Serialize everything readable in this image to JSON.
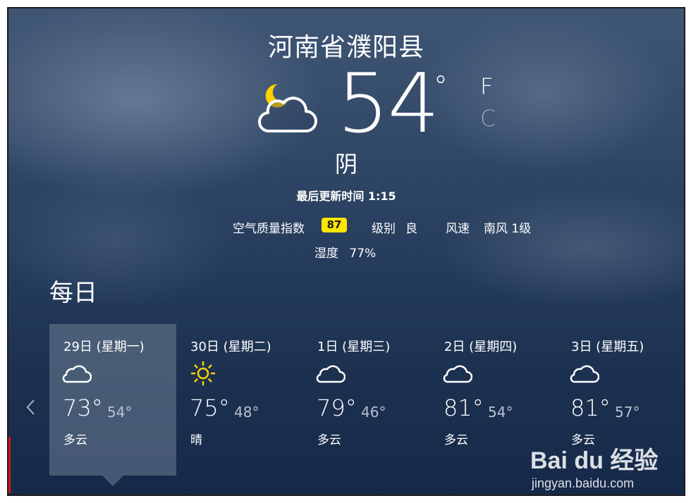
{
  "location": {
    "name": "河南省濮阳县"
  },
  "current": {
    "icon": "partly-cloudy-night-icon",
    "temperature": "54",
    "degree_symbol": "°",
    "unit_f": "F",
    "unit_c": "C",
    "active_unit": "F",
    "condition": "阴",
    "last_updated": "最后更新时间 1:15"
  },
  "details": {
    "aqi_label": "空气质量指数",
    "aqi_value": "87",
    "aqi_color": "#ffe600",
    "level_label": "级别",
    "level_value": "良",
    "wind_label": "风速",
    "wind_value": "南风 1级",
    "humidity_label": "湿度",
    "humidity_value": "77%"
  },
  "daily": {
    "title": "每日",
    "days": [
      {
        "name": "29日 (星期一)",
        "icon": "cloud-icon",
        "high": "73°",
        "low": "54°",
        "condition": "多云",
        "selected": true
      },
      {
        "name": "30日 (星期二)",
        "icon": "sun-icon",
        "high": "75°",
        "low": "48°",
        "condition": "晴",
        "selected": false
      },
      {
        "name": "1日 (星期三)",
        "icon": "cloud-icon",
        "high": "79°",
        "low": "46°",
        "condition": "多云",
        "selected": false
      },
      {
        "name": "2日 (星期四)",
        "icon": "cloud-icon",
        "high": "81°",
        "low": "54°",
        "condition": "多云",
        "selected": false
      },
      {
        "name": "3日 (星期五)",
        "icon": "cloud-icon",
        "high": "81°",
        "low": "57°",
        "condition": "多云",
        "selected": false
      }
    ]
  },
  "watermark": {
    "brand": "Bai du 经验",
    "url": "jingyan.baidu.com"
  },
  "colors": {
    "sun": "#ffd200",
    "moon": "#ffd200",
    "selected_bg": "#6e8096"
  }
}
